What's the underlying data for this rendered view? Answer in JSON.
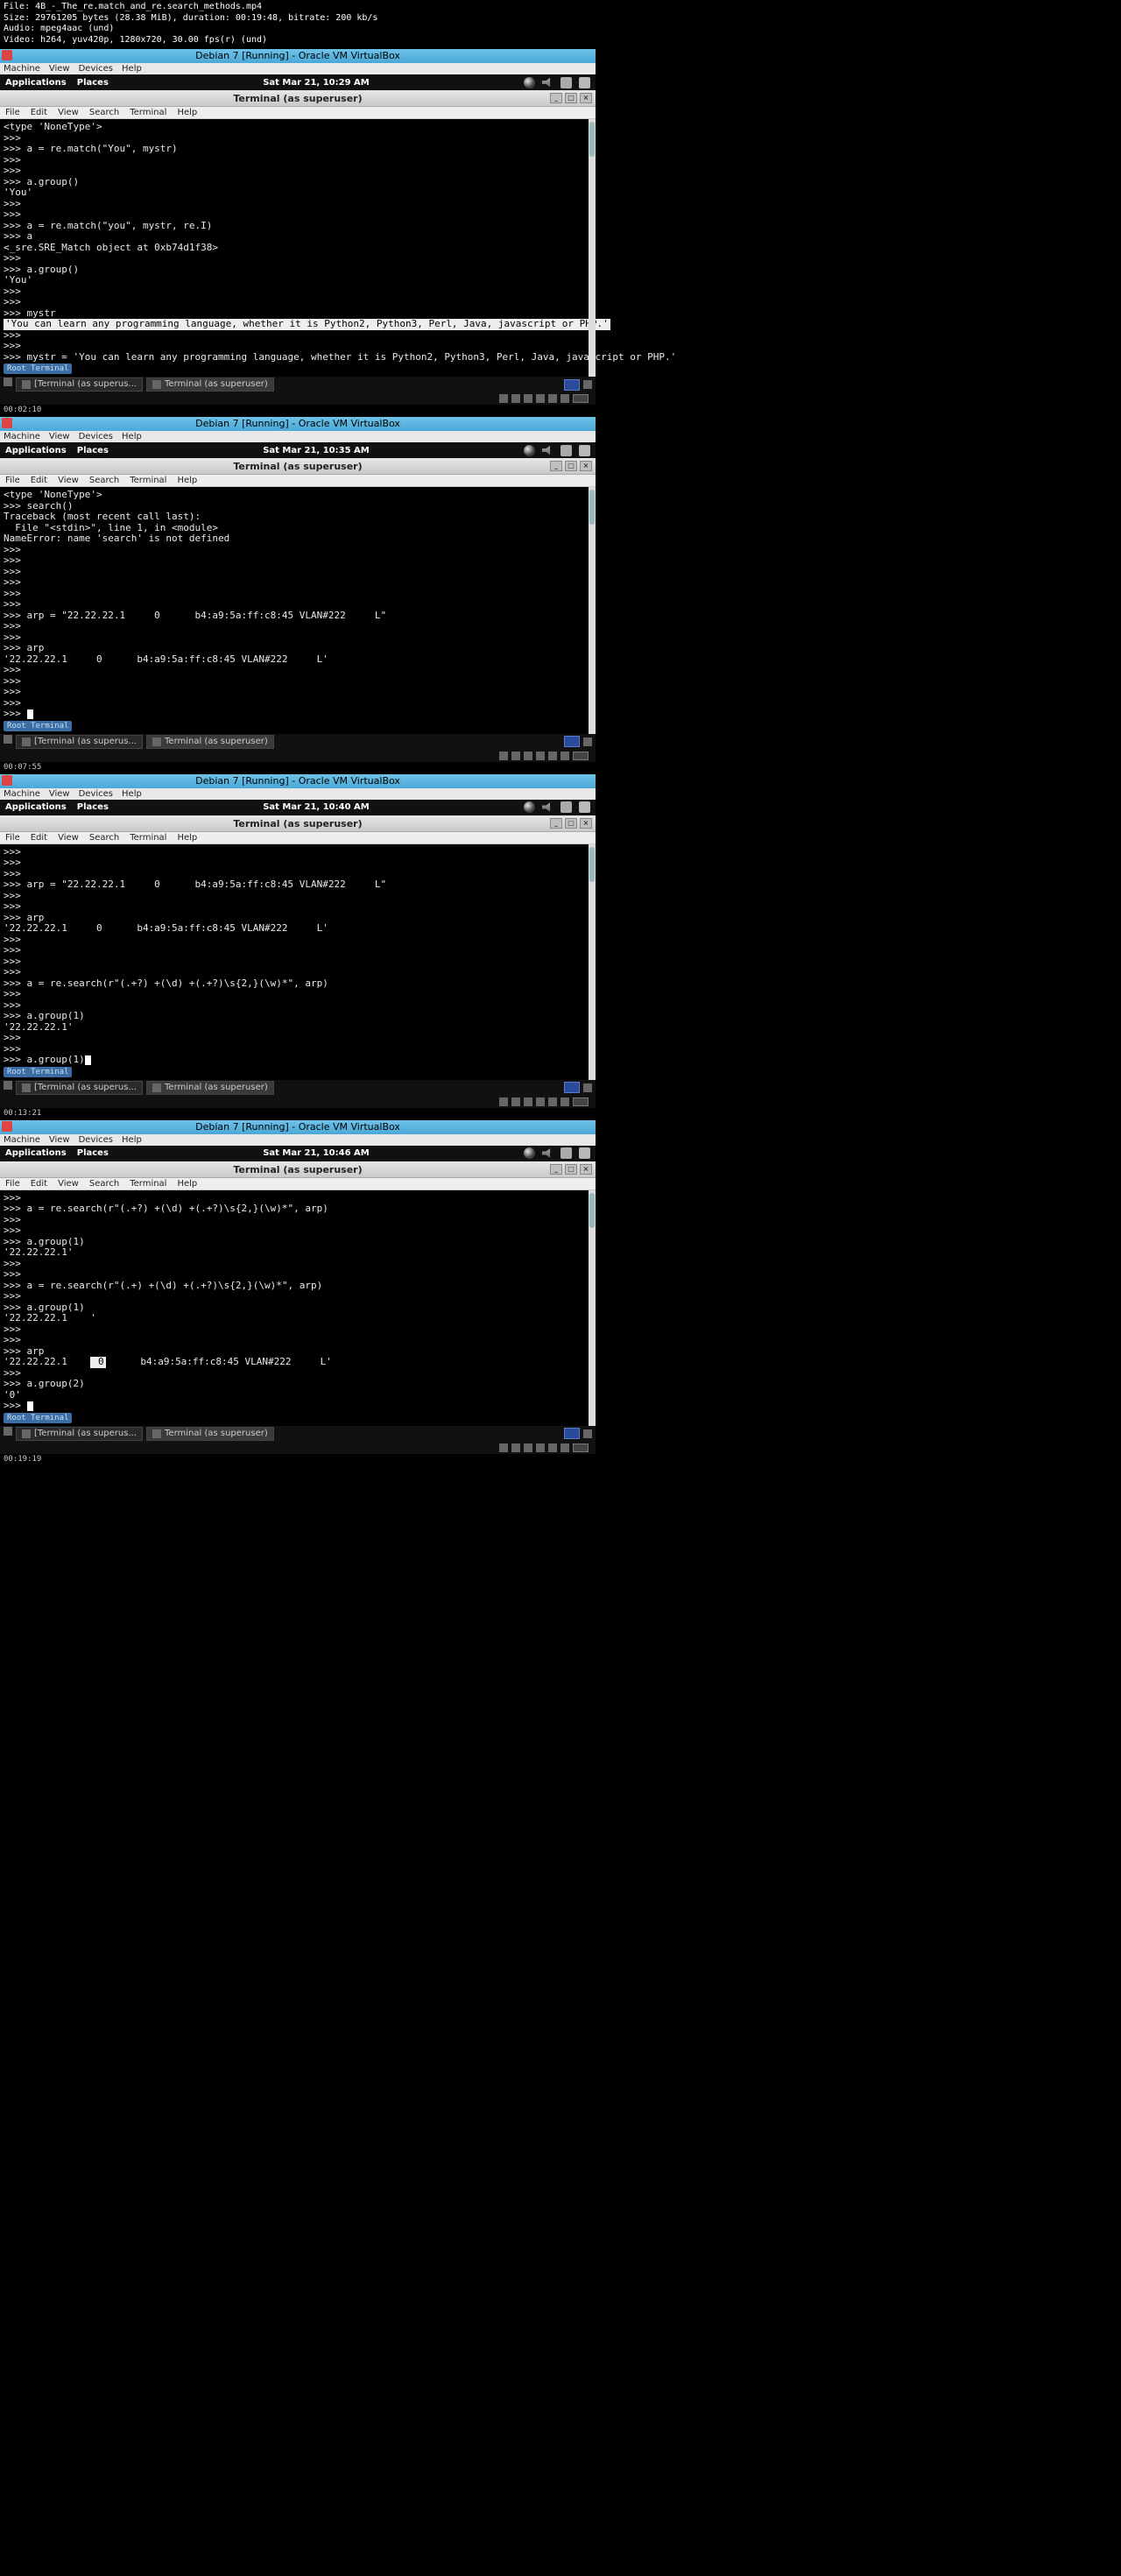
{
  "meta_header": "File: 4B_-_The_re.match_and_re.search_methods.mp4\nSize: 29761205 bytes (28.38 MiB), duration: 00:19:48, bitrate: 200 kb/s\nAudio: mpeg4aac (und)\nVideo: h264, yuv420p, 1280x720, 30.00 fps(r) (und)",
  "vbox_title": "Debian 7 [Running] - Oracle VM VirtualBox",
  "vbox_menu": [
    "Machine",
    "View",
    "Devices",
    "Help"
  ],
  "gnome": {
    "apps": "Applications",
    "places": "Places"
  },
  "term_title": "Terminal (as superuser)",
  "term_menu": [
    "File",
    "Edit",
    "View",
    "Search",
    "Terminal",
    "Help"
  ],
  "badge_root": "Root Terminal",
  "task1": "[Terminal (as superus...",
  "task2": "Terminal (as superuser)",
  "shots": [
    {
      "clock": "Sat Mar 21, 10:29 AM",
      "lines": [
        {
          "t": "<type 'NoneType'>"
        },
        {
          "t": ">>>"
        },
        {
          "t": ">>> a = re.match(\"You\", mystr)"
        },
        {
          "t": ">>>"
        },
        {
          "t": ">>>"
        },
        {
          "t": ">>> a.group()"
        },
        {
          "t": "'You'"
        },
        {
          "t": ">>>"
        },
        {
          "t": ">>>"
        },
        {
          "t": ">>> a = re.match(\"you\", mystr, re.I)"
        },
        {
          "t": ">>> a"
        },
        {
          "t": "<_sre.SRE_Match object at 0xb74d1f38>"
        },
        {
          "t": ">>>"
        },
        {
          "t": ">>> a.group()"
        },
        {
          "t": "'You'"
        },
        {
          "t": ">>>"
        },
        {
          "t": ">>>"
        },
        {
          "t": ">>> mystr"
        },
        {
          "t": "'You can learn any programming language, whether it is Python2, Python3, Perl, Java, javascript or PHP.'",
          "hl": true
        },
        {
          "t": ">>>"
        },
        {
          "t": ">>>"
        },
        {
          "t": ">>> mystr = 'You can learn any programming language, whether it is Python2, Python3, Perl, Java, javascript or PHP.'"
        }
      ],
      "ts": "00:02:10"
    },
    {
      "clock": "Sat Mar 21, 10:35 AM",
      "lines": [
        {
          "t": "<type 'NoneType'>"
        },
        {
          "t": ">>> search()"
        },
        {
          "t": "Traceback (most recent call last):"
        },
        {
          "t": "  File \"<stdin>\", line 1, in <module>"
        },
        {
          "t": "NameError: name 'search' is not defined"
        },
        {
          "t": ">>>"
        },
        {
          "t": ">>>"
        },
        {
          "t": ">>>"
        },
        {
          "t": ">>>"
        },
        {
          "t": ">>>"
        },
        {
          "t": ">>>"
        },
        {
          "t": ">>> arp = \"22.22.22.1     0      b4:a9:5a:ff:c8:45 VLAN#222     L\""
        },
        {
          "t": ">>>"
        },
        {
          "t": ">>>"
        },
        {
          "t": ">>> arp"
        },
        {
          "t": "'22.22.22.1     0      b4:a9:5a:ff:c8:45 VLAN#222     L'"
        },
        {
          "t": ">>>"
        },
        {
          "t": ">>>"
        },
        {
          "t": ">>>"
        },
        {
          "t": ">>>"
        },
        {
          "t": ">>> ",
          "cursor": true
        }
      ],
      "ts": "00:07:55"
    },
    {
      "clock": "Sat Mar 21, 10:40 AM",
      "lines": [
        {
          "t": ">>>"
        },
        {
          "t": ">>>"
        },
        {
          "t": ">>>"
        },
        {
          "t": ">>> arp = \"22.22.22.1     0      b4:a9:5a:ff:c8:45 VLAN#222     L\""
        },
        {
          "t": ">>>"
        },
        {
          "t": ">>>"
        },
        {
          "t": ">>> arp"
        },
        {
          "t": "'22.22.22.1     0      b4:a9:5a:ff:c8:45 VLAN#222     L'"
        },
        {
          "t": ">>>"
        },
        {
          "t": ">>>"
        },
        {
          "t": ">>>"
        },
        {
          "t": ">>>"
        },
        {
          "t": ">>> a = re.search(r\"(.+?) +(\\d) +(.+?)\\s{2,}(\\w)*\", arp)"
        },
        {
          "t": ">>>"
        },
        {
          "t": ">>>"
        },
        {
          "t": ">>> a.group(1)"
        },
        {
          "t": "'22.22.22.1'"
        },
        {
          "t": ">>>"
        },
        {
          "t": ">>>"
        },
        {
          "t": ">>> a.group(1)",
          "cursor": true
        }
      ],
      "ts": "00:13:21"
    },
    {
      "clock": "Sat Mar 21, 10:46 AM",
      "lines": [
        {
          "t": ">>>"
        },
        {
          "t": ">>> a = re.search(r\"(.+?) +(\\d) +(.+?)\\s{2,}(\\w)*\", arp)"
        },
        {
          "t": ">>>"
        },
        {
          "t": ">>>"
        },
        {
          "t": ">>> a.group(1)"
        },
        {
          "t": "'22.22.22.1'"
        },
        {
          "t": ">>>"
        },
        {
          "t": ">>>"
        },
        {
          "t": ">>> a = re.search(r\"(.+) +(\\d) +(.+?)\\s{2,}(\\w)*\", arp)"
        },
        {
          "t": ">>>"
        },
        {
          "t": ">>> a.group(1)"
        },
        {
          "t": "'22.22.22.1    '"
        },
        {
          "t": ">>>"
        },
        {
          "t": ">>>"
        },
        {
          "t": ">>> arp"
        },
        {
          "t": "'22.22.22.1     0      b4:a9:5a:ff:c8:45 VLAN#222     L'",
          "mark": [
            15,
            17
          ]
        },
        {
          "t": ">>>"
        },
        {
          "t": ">>> a.group(2)"
        },
        {
          "t": "'0'"
        },
        {
          "t": ">>> ",
          "cursor": true
        }
      ],
      "ts": "00:19:19"
    }
  ]
}
